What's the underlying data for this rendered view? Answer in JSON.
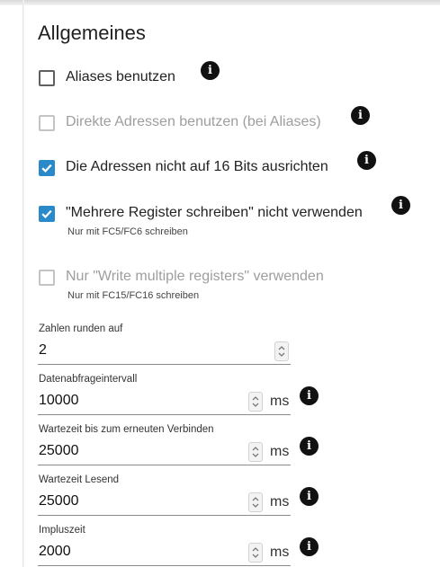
{
  "section": {
    "title": "Allgemeines"
  },
  "checkboxes": [
    {
      "label": "Aliases benutzen",
      "checked": false,
      "disabled": false
    },
    {
      "label": "Direkte Adressen benutzen (bei Aliases)",
      "checked": false,
      "disabled": true
    },
    {
      "label": "Die Adressen nicht auf 16 Bits ausrichten",
      "checked": true,
      "disabled": false
    },
    {
      "label": "\"Mehrere Register schreiben\" nicht verwenden",
      "sub": "Nur mit FC5/FC6 schreiben",
      "checked": true,
      "disabled": false
    },
    {
      "label": "Nur \"Write multiple registers\" verwenden",
      "sub": "Nur mit FC15/FC16 schreiben",
      "checked": false,
      "disabled": true
    }
  ],
  "fields": [
    {
      "label": "Zahlen runden auf",
      "value": "2",
      "unit": ""
    },
    {
      "label": "Datenabfrageintervall",
      "value": "10000",
      "unit": "ms"
    },
    {
      "label": "Wartezeit bis zum erneuten Verbinden",
      "value": "25000",
      "unit": "ms"
    },
    {
      "label": "Wartezeit Lesend",
      "value": "25000",
      "unit": "ms"
    },
    {
      "label": "Impluszeit",
      "value": "2000",
      "unit": "ms"
    }
  ],
  "icons": {
    "info": "info-icon",
    "check": "check-icon",
    "spinner": "spinner-icon"
  },
  "info_glyph": "i",
  "colors": {
    "accent": "#2a8ac9",
    "disabled": "#9e9e9e"
  }
}
